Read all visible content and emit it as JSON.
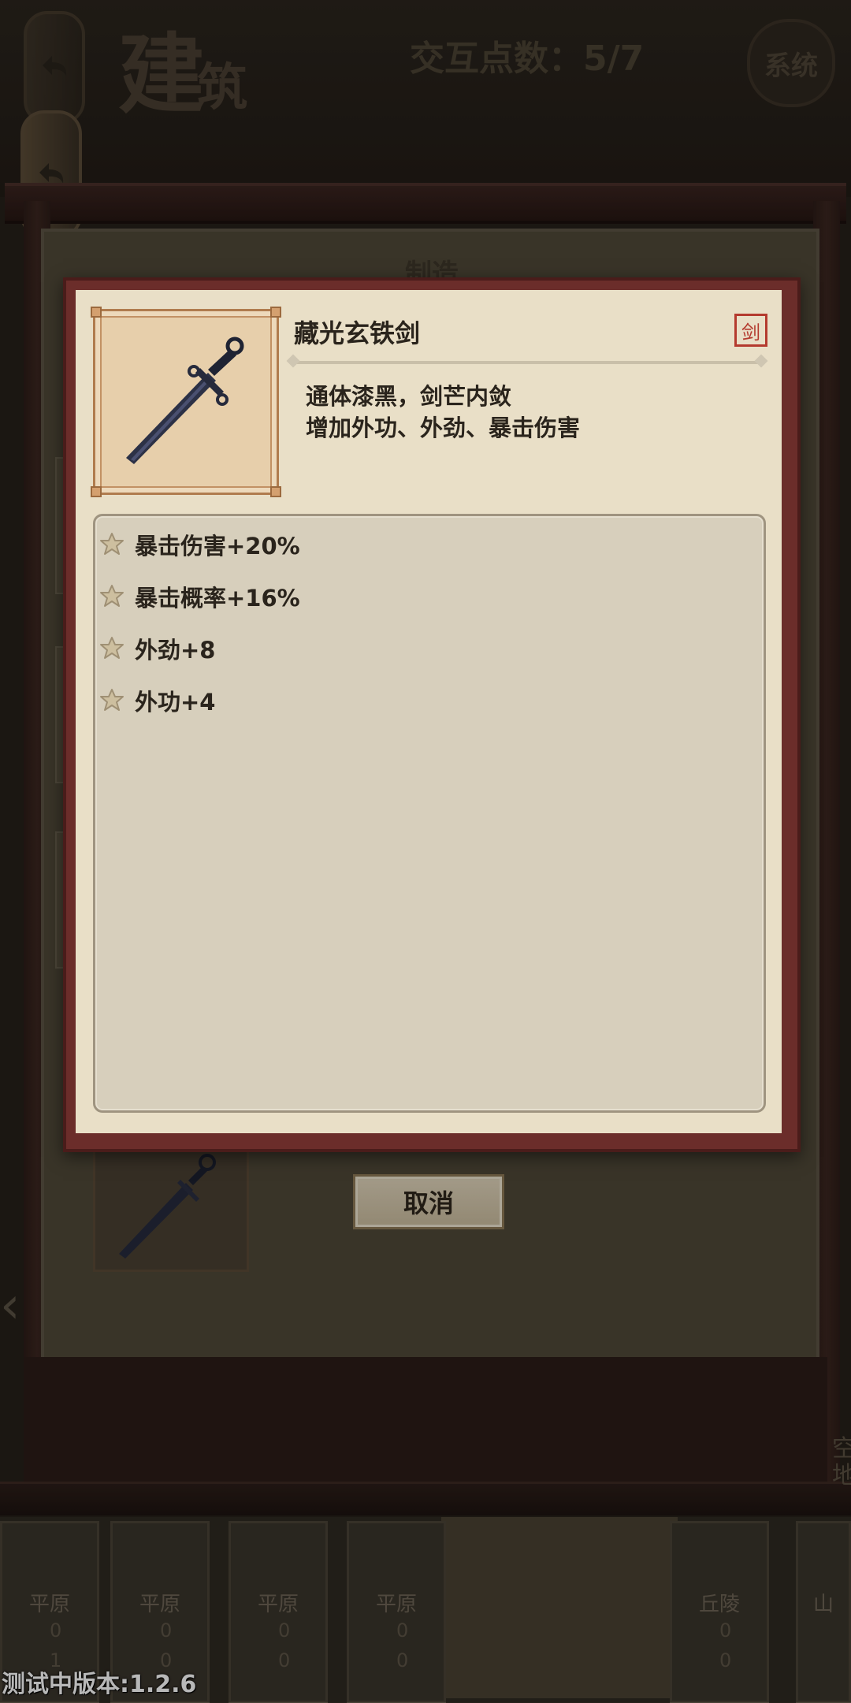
{
  "header": {
    "title_main": "建",
    "title_sub": "筑",
    "points_text": "交互点数：5/7",
    "system_label": "系统"
  },
  "panel": {
    "section_tab": "制造"
  },
  "item": {
    "name": "藏光玄铁剑",
    "type_tag": "剑",
    "description": [
      "通体漆黑，剑芒内敛",
      "增加外功、外劲、暴击伤害"
    ],
    "stats": [
      "暴击伤害+20%",
      "暴击概率+16%",
      "外劲+8",
      "外功+4"
    ]
  },
  "buttons": {
    "cancel_label": "取消"
  },
  "map_tiles": [
    {
      "terrain": "平原",
      "count_a": "0",
      "count_b": "1"
    },
    {
      "terrain": "平原",
      "count_a": "0",
      "count_b": "0"
    },
    {
      "terrain": "平原",
      "count_a": "0",
      "count_b": "0"
    },
    {
      "terrain": "平原",
      "count_a": "0",
      "count_b": "0"
    },
    {
      "terrain": "丘陵",
      "count_a": "0",
      "count_b": "0"
    },
    {
      "terrain": "山",
      "count_a": "",
      "count_b": ""
    }
  ],
  "right_edge_text": "空地",
  "version_text": "测试中版本:1.2.6",
  "colors": {
    "modal_border": "#6b2d2a",
    "modal_bg": "#e9dfc7",
    "tag_red": "#b43a2e"
  },
  "icons": [
    "undo-arrow-icon",
    "sword-icon",
    "flower-bullet-icon",
    "chevron-left-icon"
  ]
}
